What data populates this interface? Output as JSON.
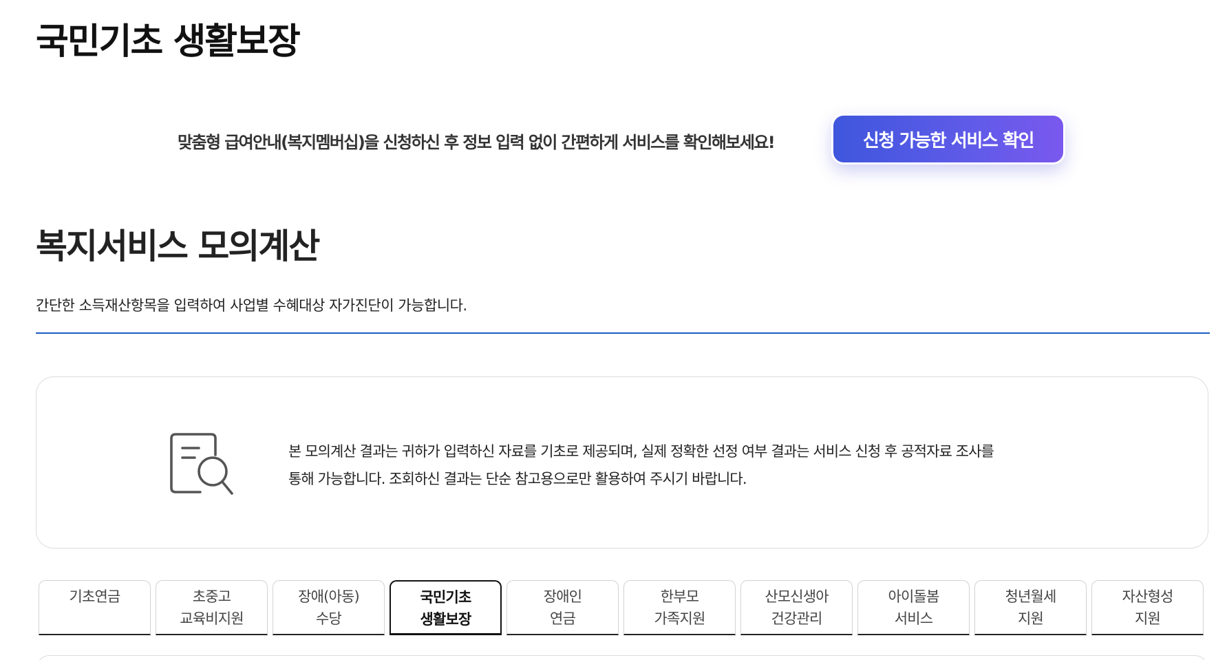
{
  "page": {
    "title": "국민기초 생활보장"
  },
  "membership": {
    "text": "맞춤형 급여안내(복지멤버십)을 신청하신 후 정보 입력 없이 간편하게 서비스를 확인해보세요!",
    "button_label": "신청 가능한 서비스 확인"
  },
  "section": {
    "title": "복지서비스 모의계산",
    "description": "간단한 소득재산항목을 입력하여 사업별 수혜대상 자가진단이 가능합니다."
  },
  "notice": {
    "icon": "document-search-icon",
    "text": "본 모의계산 결과는 귀하가 입력하신 자료를 기초로 제공되며, 실제 정확한 선정 여부 결과는 서비스 신청 후 공적자료 조사를 통해 가능합니다. 조회하신 결과는 단순 참고용으로만 활용하여 주시기 바랍니다."
  },
  "tabs": [
    {
      "line1": "기초연금",
      "line2": "",
      "active": false
    },
    {
      "line1": "초중고",
      "line2": "교육비지원",
      "active": false
    },
    {
      "line1": "장애(아동)",
      "line2": "수당",
      "active": false
    },
    {
      "line1": "국민기초",
      "line2": "생활보장",
      "active": true
    },
    {
      "line1": "장애인",
      "line2": "연금",
      "active": false
    },
    {
      "line1": "한부모",
      "line2": "가족지원",
      "active": false
    },
    {
      "line1": "산모신생아",
      "line2": "건강관리",
      "active": false
    },
    {
      "line1": "아이돌봄",
      "line2": "서비스",
      "active": false
    },
    {
      "line1": "청년월세",
      "line2": "지원",
      "active": false
    },
    {
      "line1": "자산형성",
      "line2": "지원",
      "active": false
    }
  ],
  "colors": {
    "accent_line": "#1e5fc2",
    "button_gradient_start": "#3f56dd",
    "button_gradient_end": "#7a58ee"
  }
}
